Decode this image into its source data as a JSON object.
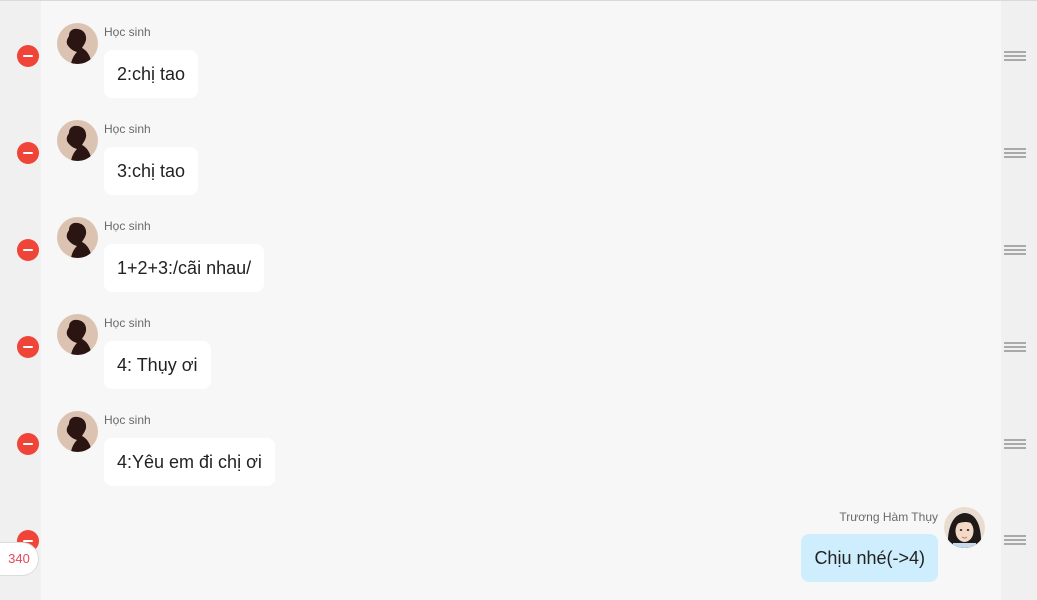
{
  "messages": [
    {
      "sender": "Học sinh",
      "text": "2:chị tao"
    },
    {
      "sender": "Học sinh",
      "text": "3:chị tao"
    },
    {
      "sender": "Học sinh",
      "text": "1+2+3:/cãi nhau/"
    },
    {
      "sender": "Học sinh",
      "text": "4: Thụy ơi"
    },
    {
      "sender": "Học sinh",
      "text": "4:Yêu em đi chị ơi"
    },
    {
      "sender": "Trương Hàm Thụy",
      "text": "Chịu nhé(->4)"
    }
  ],
  "counter": "340",
  "colors": {
    "remove": "#f04438",
    "my_bubble": "#cfeefd",
    "counter_text": "#e5485c"
  },
  "icons": {
    "remove": "minus-circle-icon",
    "drag": "drag-handle-icon"
  }
}
